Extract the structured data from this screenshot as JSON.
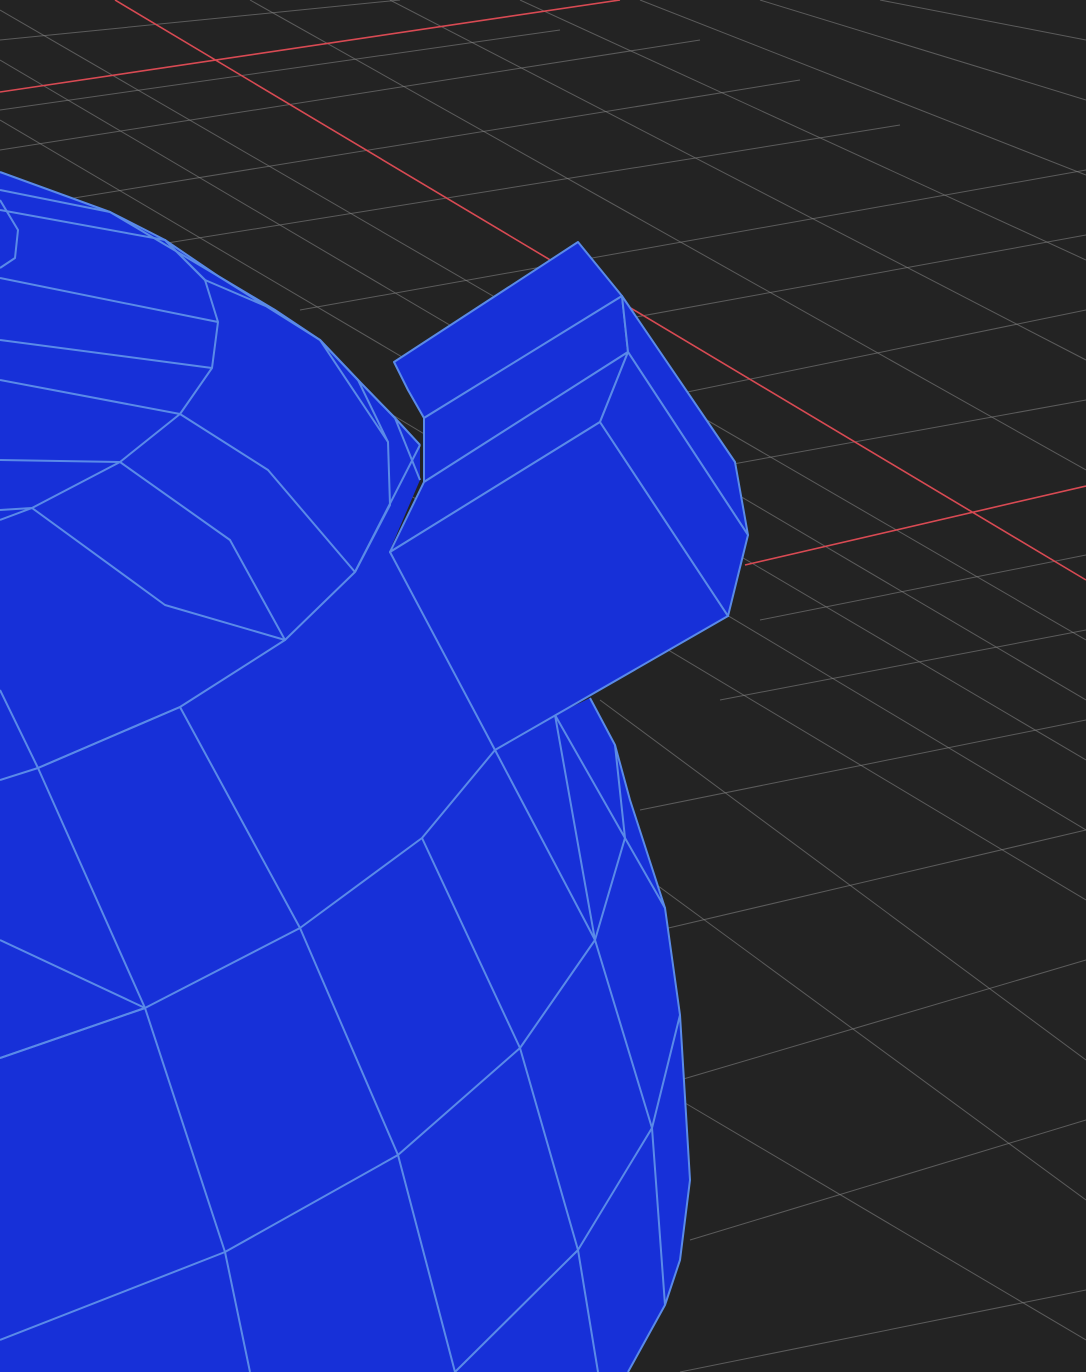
{
  "viewport": {
    "background_color": "#232323",
    "grid_color": "#8a8a8a",
    "x_axis_color": "#d84a53",
    "mesh_color": "#1730d8",
    "edge_color": "#5a8ae8",
    "objects": [
      "sphere-mesh",
      "cube-mesh"
    ]
  }
}
